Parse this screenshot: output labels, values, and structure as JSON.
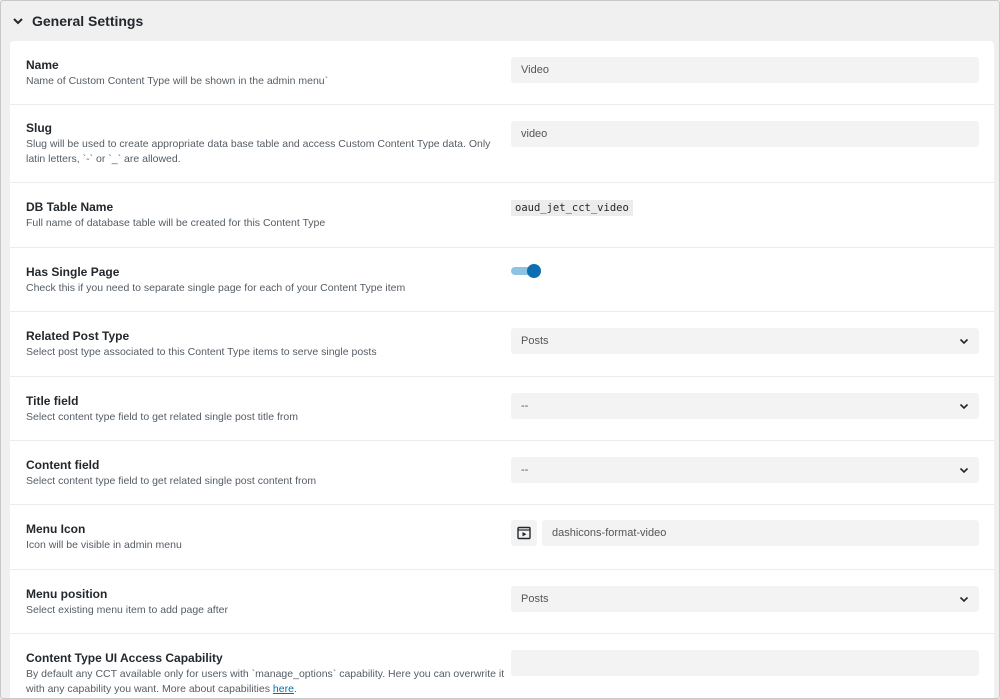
{
  "section": {
    "title": "General Settings"
  },
  "rows": {
    "name": {
      "label": "Name",
      "desc": "Name of Custom Content Type will be shown in the admin menu`",
      "value": "Video"
    },
    "slug": {
      "label": "Slug",
      "desc_line1": "Slug will be used to create appropriate data base table and access Custom Content Type data. Only",
      "desc_line2": "latin letters, `-` or `_` are allowed.",
      "value": "video"
    },
    "db_table": {
      "label": "DB Table Name",
      "desc": "Full name of database table will be created for this Content Type",
      "value": "oaud_jet_cct_video"
    },
    "single_page": {
      "label": "Has Single Page",
      "desc": "Check this if you need to separate single page for each of your Content Type item",
      "enabled": true
    },
    "related_post_type": {
      "label": "Related Post Type",
      "desc": "Select post type associated to this Content Type items to serve single posts",
      "value": "Posts"
    },
    "title_field": {
      "label": "Title field",
      "desc": "Select content type field to get related single post title from",
      "value": "--"
    },
    "content_field": {
      "label": "Content field",
      "desc": "Select content type field to get related single post content from",
      "value": "--"
    },
    "menu_icon": {
      "label": "Menu Icon",
      "desc": "Icon will be visible in admin menu",
      "value": "dashicons-format-video"
    },
    "menu_position": {
      "label": "Menu position",
      "desc": "Select existing menu item to add page after",
      "value": "Posts"
    },
    "capability": {
      "label": "Content Type UI Access Capability",
      "desc_line1": "By default any CCT available only for users with `manage_options` capability. Here you can overwrite it",
      "desc_line2": "with any capability you want. More about capabilities ",
      "link_text": "here",
      "desc_end": ".",
      "value": ""
    }
  },
  "colors": {
    "accent": "#0b6fb1",
    "toggle_track": "#8ec2e3",
    "link": "#0073aa"
  }
}
